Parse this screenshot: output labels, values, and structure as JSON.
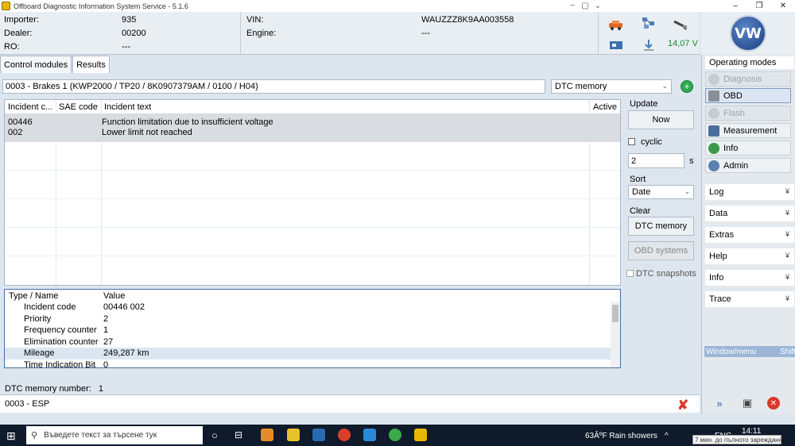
{
  "window": {
    "title": "Offboard Diagnostic Information System Service - 5.1.6",
    "minimize": "–",
    "restore": "❐",
    "close": "✕",
    "extra_buttons": [
      "−",
      "▢",
      "⌄"
    ]
  },
  "header": {
    "importer_label": "Importer:",
    "importer_value": "935",
    "dealer_label": "Dealer:",
    "dealer_value": "00200",
    "ro_label": "RO:",
    "ro_value": "---",
    "vin_label": "VIN:",
    "vin_value": "WAUZZZ8K9AA003558",
    "engine_label": "Engine:",
    "engine_value": "---",
    "voltage": "14,07 V",
    "logo_text": "VW"
  },
  "tabs": [
    {
      "label": "Control modules",
      "active": false
    },
    {
      "label": "Results",
      "active": true
    }
  ],
  "module": {
    "description": "0003 - Brakes 1  (KWP2000 / TP20 / 8K0907379AM / 0100 / H04)",
    "view_select": "DTC memory"
  },
  "dtc_table": {
    "headers": [
      "Incident c...",
      "SAE code",
      "Incident text",
      "Active"
    ],
    "rows": [
      {
        "code": "00446",
        "sae": "",
        "text": "Function limitation due to insufficient voltage",
        "active": ""
      },
      {
        "code": "002",
        "sae": "",
        "text": "Lower limit not reached",
        "active": ""
      }
    ]
  },
  "controls": {
    "update_label": "Update",
    "now_button": "Now",
    "cyclic_label": "cyclic",
    "interval_value": "2",
    "interval_unit": "s",
    "sort_label": "Sort",
    "sort_value": "Date",
    "clear_label": "Clear",
    "dtc_memory_button": "DTC memory",
    "obd_systems_button": "OBD systems",
    "dtc_snapshots_label": "DTC snapshots"
  },
  "details": {
    "headers": [
      "Type / Name",
      "Value"
    ],
    "rows": [
      {
        "name": "Incident code",
        "value": "00446 002"
      },
      {
        "name": "Priority",
        "value": "2"
      },
      {
        "name": "Frequency counter",
        "value": "1"
      },
      {
        "name": "Elimination counter / c",
        "value": "27"
      },
      {
        "name": "Mileage",
        "value": "249,287 km"
      },
      {
        "name": "Time Indication Bit",
        "value": "0"
      }
    ],
    "selected_index": 4
  },
  "status": {
    "dtc_count_text": "DTC memory number:",
    "dtc_count": "1",
    "esp_text": "0003 - ESP"
  },
  "sidebar": {
    "operating_modes": "Operating modes",
    "modes": [
      {
        "label": "Diagnosis",
        "state": "disabled"
      },
      {
        "label": "OBD",
        "state": "active"
      },
      {
        "label": "Flash",
        "state": "disabled"
      },
      {
        "label": "Measurement",
        "state": "normal"
      },
      {
        "label": "Info",
        "state": "normal"
      },
      {
        "label": "Admin",
        "state": "normal"
      }
    ],
    "groups": [
      "Log",
      "Data",
      "Extras",
      "Help",
      "Info",
      "Trace"
    ],
    "window_menu": "Window/menu",
    "window_menu_shortcut": "Shift"
  },
  "taskbar": {
    "search_placeholder": "Въведете текст за търсене тук",
    "weather": "63ÂºF  Rain showers",
    "time": "14:11",
    "lang": "ENG",
    "tooltip": "7 мин. до пълното зареждане"
  },
  "colors": {
    "accent_green": "#1a8a2a",
    "selection": "#d9dde1",
    "window_menu": "#9bb6d6"
  }
}
